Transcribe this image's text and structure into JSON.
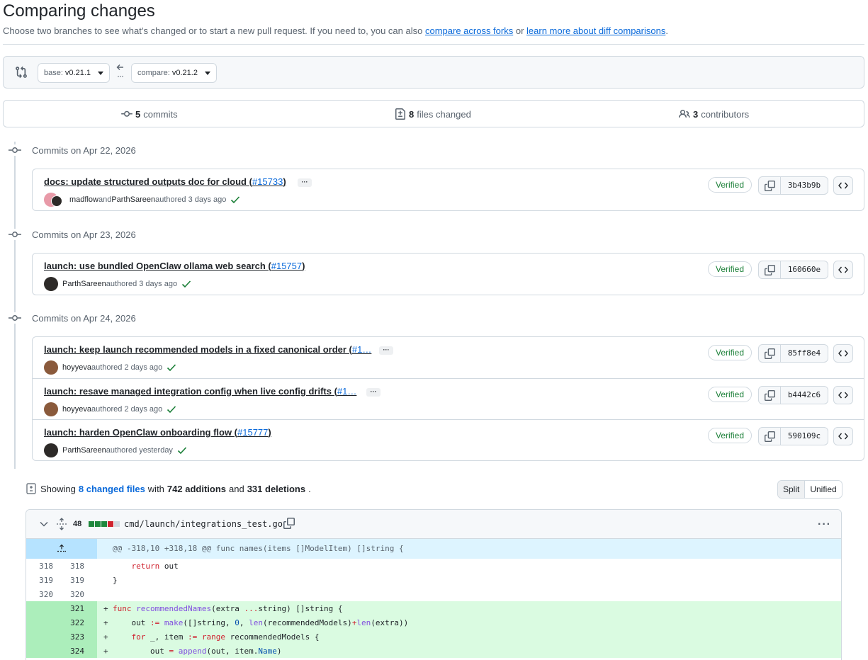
{
  "header": {
    "title": "Comparing changes",
    "desc_prefix": "Choose two branches to see what’s changed or to start a new pull request. If you need to, you can also ",
    "link_forks": "compare across forks",
    "desc_or": " or ",
    "link_learn": "learn more about diff comparisons",
    "desc_suffix": "."
  },
  "range": {
    "base_label": "base:",
    "base_value": "v0.21.1",
    "compare_label": "compare:",
    "compare_value": "v0.21.2"
  },
  "stats": {
    "commits_count": "5",
    "commits_label": "commits",
    "files_count": "8",
    "files_label": "files changed",
    "contributors_count": "3",
    "contributors_label": "contributors"
  },
  "groups": [
    {
      "heading": "Commits on Apr 22, 2026"
    },
    {
      "heading": "Commits on Apr 23, 2026"
    },
    {
      "heading": "Commits on Apr 24, 2026"
    }
  ],
  "commits": [
    {
      "title": "docs: update structured outputs doc for cloud (",
      "pr": "#15733",
      "close": ")",
      "author": "madflow",
      "and": " and ",
      "coauthor": "ParthSareen",
      "meta": " authored 3 days ago",
      "verified": "Verified",
      "sha": "3b43b9b"
    },
    {
      "title": "launch: use bundled OpenClaw ollama web search (",
      "pr": "#15757",
      "close": ")",
      "author": "ParthSareen",
      "meta": " authored 3 days ago",
      "verified": "Verified",
      "sha": "160660e"
    },
    {
      "title": "launch: keep launch recommended models in a fixed canonical order (",
      "pr": "#1…",
      "close": "",
      "author": "hoyyeva",
      "meta": " authored 2 days ago",
      "verified": "Verified",
      "sha": "85ff8e4"
    },
    {
      "title": "launch: resave managed integration config when live config drifts (",
      "pr": "#1…",
      "close": "",
      "author": "hoyyeva",
      "meta": " authored 2 days ago",
      "verified": "Verified",
      "sha": "b4442c6"
    },
    {
      "title": "launch: harden OpenClaw onboarding flow (",
      "pr": "#15777",
      "close": ")",
      "author": "ParthSareen",
      "meta": " authored yesterday",
      "verified": "Verified",
      "sha": "590109c"
    }
  ],
  "summary": {
    "prefix": "Showing",
    "files_link": "8 changed files",
    "with": "with",
    "additions": "742 additions",
    "and": "and",
    "deletions": "331 deletions",
    "end": "."
  },
  "view_toggle": {
    "split": "Split",
    "unified": "Unified"
  },
  "file": {
    "changes": "48",
    "name": "cmd/launch/integrations_test.go",
    "hunk": "@@ -318,10 +318,18 @@ func names(items []ModelItem) []string {",
    "lines": [
      {
        "old": "318",
        "new": "318",
        "sign": "",
        "code": "    return out",
        "type": "ctx"
      },
      {
        "old": "319",
        "new": "319",
        "sign": "",
        "code": "}",
        "type": "ctx"
      },
      {
        "old": "320",
        "new": "320",
        "sign": "",
        "code": "",
        "type": "ctx"
      },
      {
        "old": "",
        "new": "321",
        "sign": "+",
        "code": "func recommendedNames(extra ...string) []string {",
        "type": "add"
      },
      {
        "old": "",
        "new": "322",
        "sign": "+",
        "code": "    out := make([]string, 0, len(recommendedModels)+len(extra))",
        "type": "add"
      },
      {
        "old": "",
        "new": "323",
        "sign": "+",
        "code": "    for _, item := range recommendedModels {",
        "type": "add"
      },
      {
        "old": "",
        "new": "324",
        "sign": "+",
        "code": "        out = append(out, item.Name)",
        "type": "add"
      }
    ]
  }
}
